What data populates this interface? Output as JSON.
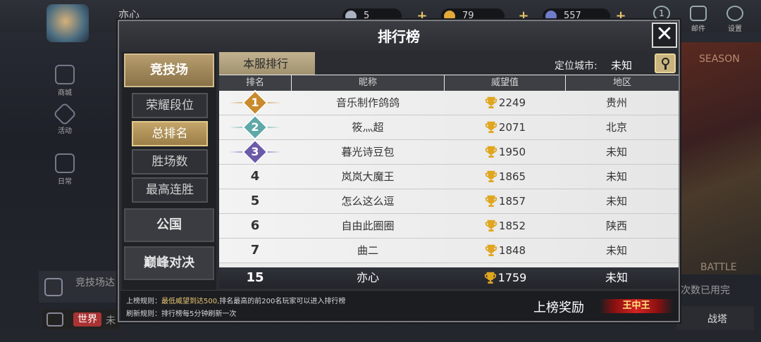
{
  "hud": {
    "player_name": "亦心",
    "resources": [
      "5",
      "79",
      "557"
    ],
    "badge_count": "1",
    "mail_label": "邮件",
    "settings_label": "设置"
  },
  "left_nav": [
    "商城",
    "活动",
    "日常"
  ],
  "background": {
    "bottom_text": "竞技场达",
    "world_tag": "世界",
    "world_text": "未",
    "right_text": "次数已用完",
    "battle_label": "战塔",
    "season_label": "SEASON",
    "battle_en": "BATTLE"
  },
  "modal": {
    "title": "排行榜",
    "close": "✕"
  },
  "side_menu": {
    "arena": "竞技场",
    "sub_tabs": [
      "荣耀段位",
      "总排名",
      "胜场数",
      "最高连胜"
    ],
    "guild": "公国",
    "peak": "巅峰对决"
  },
  "panel": {
    "server_tab": "本服排行",
    "city_label": "定位城市:",
    "city_value": "未知",
    "columns": [
      "排名",
      "昵称",
      "威望值",
      "地区"
    ]
  },
  "rows": [
    {
      "rank": "1",
      "name": "音乐制作鸽鸽",
      "score": "2249",
      "region": "贵州"
    },
    {
      "rank": "2",
      "name": "筱灬超",
      "score": "2071",
      "region": "北京"
    },
    {
      "rank": "3",
      "name": "暮光诗豆包",
      "score": "1950",
      "region": "未知"
    },
    {
      "rank": "4",
      "name": "岚岚大魔王",
      "score": "1865",
      "region": "未知"
    },
    {
      "rank": "5",
      "name": "怎么这么逗",
      "score": "1857",
      "region": "未知"
    },
    {
      "rank": "6",
      "name": "自由此圈圈",
      "score": "1852",
      "region": "陕西"
    },
    {
      "rank": "7",
      "name": "曲二",
      "score": "1848",
      "region": "未知"
    }
  ],
  "self_row": {
    "rank": "15",
    "name": "亦心",
    "score": "1759",
    "region": "未知"
  },
  "footer": {
    "rule1_prefix": "上榜规则：",
    "rule1_highlight": "最低威望到达500,",
    "rule1_suffix": "排名最高的前200名玩家可以进入排行榜",
    "rule2_prefix": "刷新规则：",
    "rule2_text": "排行榜每5分钟刷新一次",
    "reward_label": "上榜奖励",
    "reward_badge": "王中王"
  },
  "colors": {
    "medal_gold": "#c98a2c",
    "medal_silver": "#5fa8a8",
    "medal_bronze": "#6a5aa8",
    "trophy": "#e0a620"
  }
}
